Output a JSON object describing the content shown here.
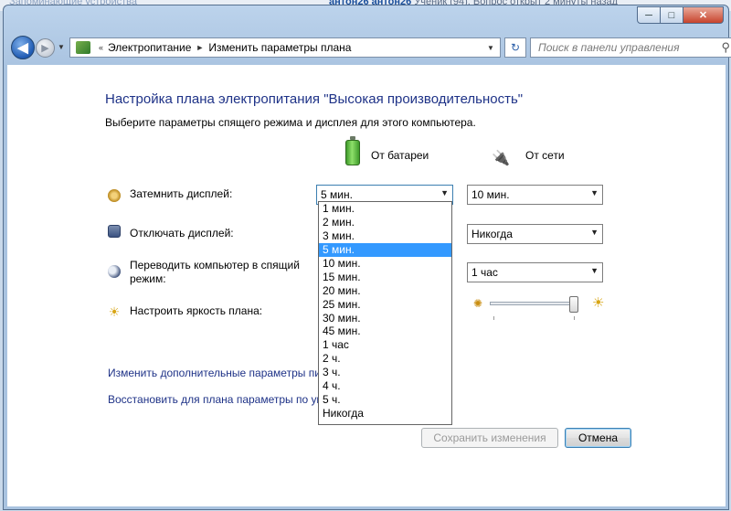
{
  "background": {
    "left_text": "Запоминающие устройства",
    "top_text_user": "антон26 антон26",
    "top_text_rest": " Ученик (94). Вопрос открыт 2 минуты назад"
  },
  "window": {
    "minimize": "─",
    "maximize": "□",
    "close": "✕"
  },
  "nav": {
    "back_glyph": "◀",
    "forward_glyph": "▶",
    "history_glyph": "▼",
    "breadcrumb": [
      "Электропитание",
      "Изменить параметры плана"
    ],
    "crumb_sep": "►",
    "crumb_root": "«",
    "refresh_glyph": "↻",
    "search_placeholder": "Поиск в панели управления",
    "search_glyph": "⚲"
  },
  "page": {
    "title": "Настройка плана электропитания \"Высокая производительность\"",
    "subtitle": "Выберите параметры спящего режима и дисплея для этого компьютера.",
    "col_battery": "От батареи",
    "col_ac": "От сети"
  },
  "settings": {
    "dim": {
      "label": "Затемнить дисплей:",
      "battery": "5 мин.",
      "ac": "10 мин."
    },
    "off": {
      "label": "Отключать дисплей:",
      "ac": "Никогда"
    },
    "sleep": {
      "label_line1": "Переводить компьютер в спящий",
      "label_line2": "режим:",
      "ac": "1 час"
    },
    "brightness": {
      "label": "Настроить яркость плана:",
      "ac_level": 1.0
    }
  },
  "dropdown": {
    "options": [
      "1 мин.",
      "2 мин.",
      "3 мин.",
      "5 мин.",
      "10 мин.",
      "15 мин.",
      "20 мин.",
      "25 мин.",
      "30 мин.",
      "45 мин.",
      "1 час",
      "2 ч.",
      "3 ч.",
      "4 ч.",
      "5 ч.",
      "Никогда"
    ],
    "selected": "5 мин."
  },
  "links": {
    "advanced": "Изменить дополнительные параметры пи",
    "restore": "Восстановить для плана параметры по ум"
  },
  "buttons": {
    "save": "Сохранить изменения",
    "cancel": "Отмена"
  },
  "icons": {
    "dim": "dim-display-icon",
    "off": "display-off-icon",
    "sleep": "sleep-icon",
    "brightness": "brightness-icon",
    "battery": "battery-icon",
    "plug": "power-plug-icon"
  }
}
